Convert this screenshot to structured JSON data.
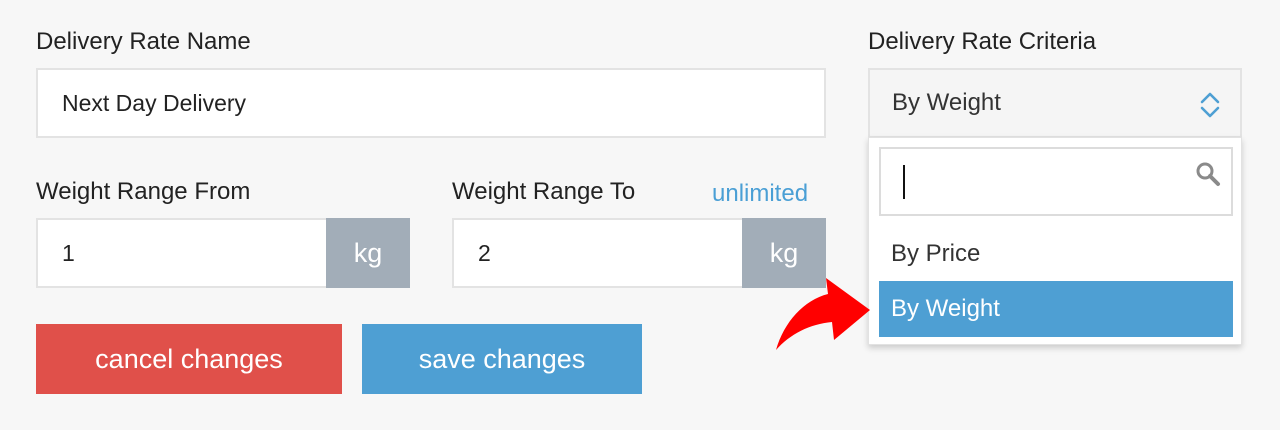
{
  "rate_name": {
    "label": "Delivery Rate Name",
    "value": "Next Day Delivery"
  },
  "criteria": {
    "label": "Delivery Rate Criteria",
    "selected": "By Weight",
    "chevron_icon": "up-down-chevron-icon",
    "search_icon": "magnifier-icon",
    "search_value": "",
    "options": [
      "By Price",
      "By Weight"
    ],
    "highlighted_option": "By Weight"
  },
  "weight_from": {
    "label": "Weight Range From",
    "value": "1",
    "unit": "kg"
  },
  "weight_to": {
    "label": "Weight Range To",
    "value": "2",
    "unit": "kg",
    "unlimited_link": "unlimited"
  },
  "buttons": {
    "cancel": "cancel changes",
    "save": "save changes"
  },
  "annotation": {
    "arrow_icon": "red-curved-arrow-icon"
  },
  "colors": {
    "accent_blue": "#4e9fd3",
    "cancel_red": "#e0504a",
    "unit_gray": "#a2adb8",
    "arrow_red": "#ff0000"
  }
}
